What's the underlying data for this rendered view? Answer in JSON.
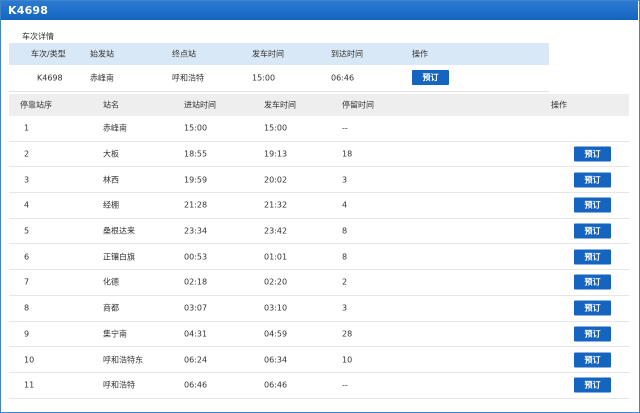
{
  "window": {
    "title": "K4698"
  },
  "section_title": "车次详情",
  "info": {
    "headers": [
      "车次/类型",
      "始发站",
      "终点站",
      "发车时间",
      "到达时间",
      "操作"
    ],
    "row": {
      "train": "K4698",
      "from": "赤峰南",
      "to": "呼和浩特",
      "depart": "15:00",
      "arrive": "06:46",
      "button": "预订"
    }
  },
  "stops_headers": [
    "停靠站序",
    "站名",
    "进站时间",
    "发车时间",
    "停留时间",
    "操作"
  ],
  "stops": [
    {
      "seq": "1",
      "name": "赤峰南",
      "arrive": "15:00",
      "depart": "15:00",
      "stay": "--",
      "button": ""
    },
    {
      "seq": "2",
      "name": "大板",
      "arrive": "18:55",
      "depart": "19:13",
      "stay": "18",
      "button": "预订"
    },
    {
      "seq": "3",
      "name": "林西",
      "arrive": "19:59",
      "depart": "20:02",
      "stay": "3",
      "button": "预订"
    },
    {
      "seq": "4",
      "name": "经棚",
      "arrive": "21:28",
      "depart": "21:32",
      "stay": "4",
      "button": "预订"
    },
    {
      "seq": "5",
      "name": "桑根达来",
      "arrive": "23:34",
      "depart": "23:42",
      "stay": "8",
      "button": "预订"
    },
    {
      "seq": "6",
      "name": "正镶白旗",
      "arrive": "00:53",
      "depart": "01:01",
      "stay": "8",
      "button": "预订"
    },
    {
      "seq": "7",
      "name": "化德",
      "arrive": "02:18",
      "depart": "02:20",
      "stay": "2",
      "button": "预订"
    },
    {
      "seq": "8",
      "name": "商都",
      "arrive": "03:07",
      "depart": "03:10",
      "stay": "3",
      "button": "预订"
    },
    {
      "seq": "9",
      "name": "集宁南",
      "arrive": "04:31",
      "depart": "04:59",
      "stay": "28",
      "button": "预订"
    },
    {
      "seq": "10",
      "name": "呼和浩特东",
      "arrive": "06:24",
      "depart": "06:34",
      "stay": "10",
      "button": "预订"
    },
    {
      "seq": "11",
      "name": "呼和浩特",
      "arrive": "06:46",
      "depart": "06:46",
      "stay": "--",
      "button": "预订"
    }
  ],
  "colors": {
    "accent": "#1565c0",
    "header_bg": "#d9e8f6",
    "table_head_bg": "#eeeeee"
  }
}
